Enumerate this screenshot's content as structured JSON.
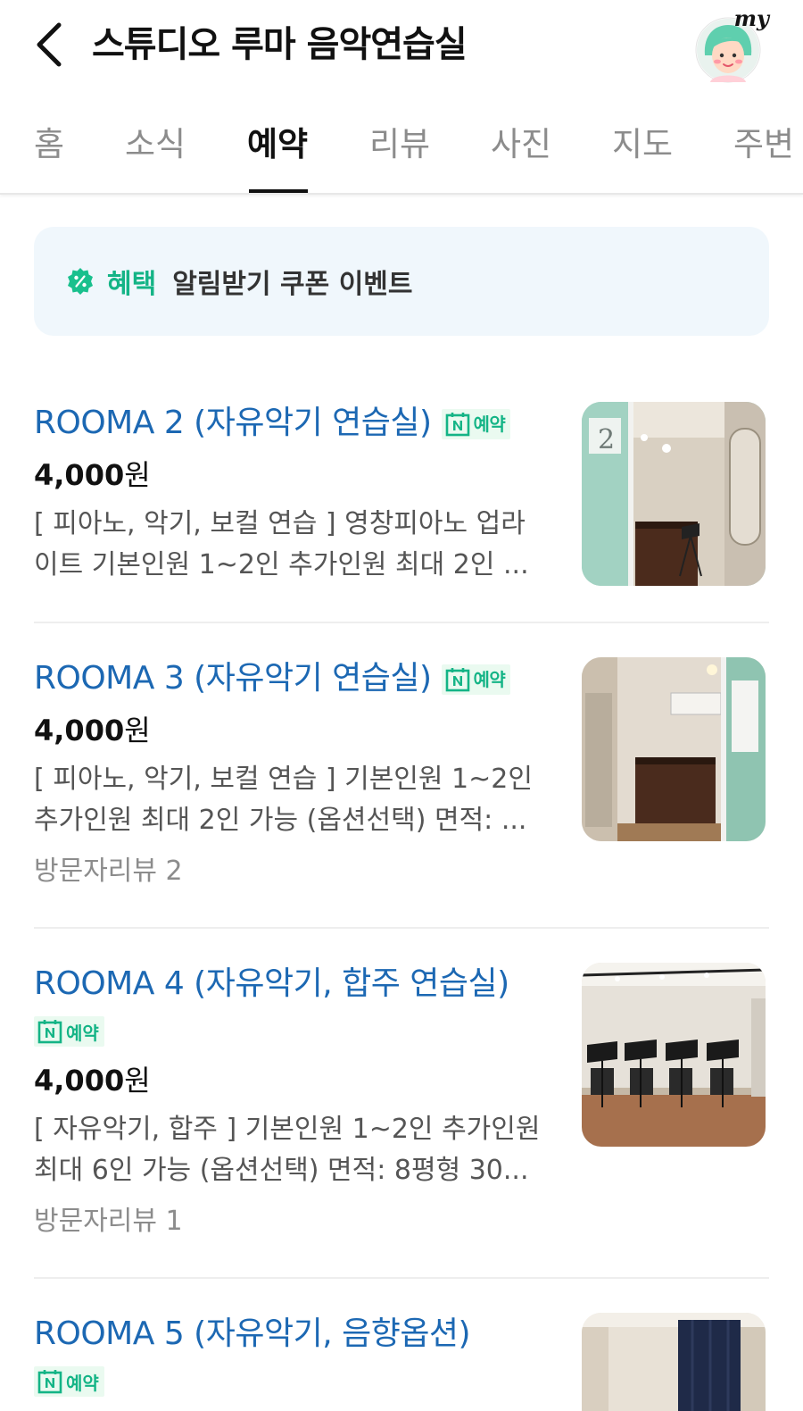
{
  "header": {
    "title": "스튜디오 루마 음악연습실",
    "my_label": "my"
  },
  "tabs": [
    {
      "label": "홈"
    },
    {
      "label": "소식"
    },
    {
      "label": "예약"
    },
    {
      "label": "리뷰"
    },
    {
      "label": "사진"
    },
    {
      "label": "지도"
    },
    {
      "label": "주변"
    }
  ],
  "active_tab": "예약",
  "benefit": {
    "title": "혜택",
    "text": "알림받기 쿠폰 이벤트"
  },
  "booking_badge": {
    "logo": "N",
    "label": "예약"
  },
  "rooms": [
    {
      "name": "ROOMA 2 (자유악기 연습실)",
      "price": "4,000",
      "price_unit": "원",
      "desc_line1": "[ 피아노, 악기, 보컬 연습 ] 영창피아노 업라",
      "desc_line2": "이트 기본인원 1~2인 추가인원 최대 2인 ...",
      "reviews": ""
    },
    {
      "name": "ROOMA 3 (자유악기 연습실)",
      "price": "4,000",
      "price_unit": "원",
      "desc_line1": "[ 피아노, 악기, 보컬 연습 ] 기본인원 1~2인",
      "desc_line2": "추가인원 최대 2인 가능 (옵션선택) 면적: ...",
      "reviews": "방문자리뷰 2"
    },
    {
      "name": "ROOMA 4 (자유악기, 합주 연습실)",
      "price": "4,000",
      "price_unit": "원",
      "desc_line1": "[ 자유악기, 합주 ] 기본인원 1~2인 추가인원",
      "desc_line2": "최대 6인 가능 (옵션선택) 면적: 8평형 30...",
      "reviews": "방문자리뷰 1"
    },
    {
      "name": "ROOMA 5 (자유악기, 음향옵션)",
      "price": "",
      "price_unit": "",
      "desc_line1": "",
      "desc_line2": "",
      "reviews": ""
    }
  ],
  "colors": {
    "link_blue": "#1c68b3",
    "naver_green": "#14b486",
    "banner_bg": "#f0f7fc"
  }
}
